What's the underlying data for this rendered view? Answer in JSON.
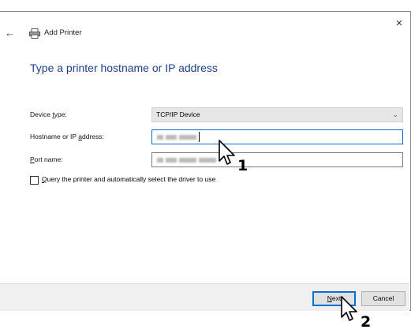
{
  "window": {
    "title": "Add Printer",
    "close_glyph": "×",
    "back_glyph": "←"
  },
  "heading": "Type a printer hostname or IP address",
  "form": {
    "device_type": {
      "label_pre": "Device ",
      "label_key": "t",
      "label_post": "ype:",
      "value": "TCP/IP Device"
    },
    "hostname": {
      "label_pre": "Hostname or IP ",
      "label_key": "a",
      "label_post": "ddress:"
    },
    "port": {
      "label_pre": "",
      "label_key": "P",
      "label_post": "ort name:"
    },
    "query": {
      "label_key": "Q",
      "label_post": "uery the printer and automatically select the driver to use",
      "checked": false
    }
  },
  "buttons": {
    "next_key": "N",
    "next_post": "ext",
    "cancel": "Cancel"
  },
  "steps": {
    "step1": "1",
    "step2": "2"
  },
  "icons": {
    "printer": "printer-icon",
    "chevron": "chevron-down-icon",
    "cursor": "mouse-pointer-icon"
  },
  "colors": {
    "heading": "#1f3f8f",
    "focus": "#0b6fd0"
  }
}
